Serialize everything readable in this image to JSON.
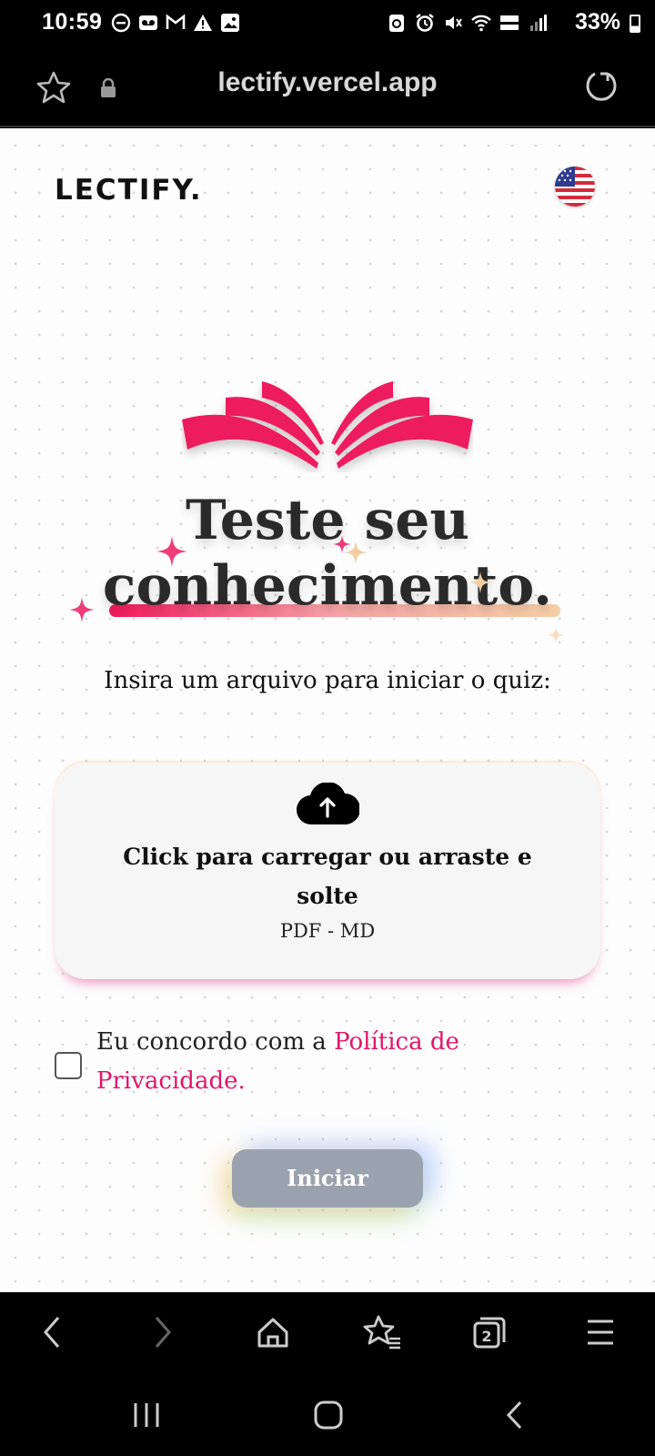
{
  "status_bar": {
    "time": "10:59",
    "battery": "33%"
  },
  "browser": {
    "url": "lectify.vercel.app"
  },
  "header": {
    "logo": "LECTIFY.",
    "language_icon": "us-flag-icon"
  },
  "hero": {
    "title_line1": "Teste seu",
    "title_line2": "conhecimento.",
    "subtitle": "Insira um arquivo para iniciar o quiz:"
  },
  "upload": {
    "text": "Click para carregar ou arraste e solte",
    "formats": "PDF - MD"
  },
  "consent": {
    "text": "Eu concordo com a ",
    "link": "Política de Privacidade.",
    "checked": false
  },
  "actions": {
    "start_label": "Iniciar"
  },
  "colors": {
    "accent": "#e0176a",
    "button_disabled": "#9aa2ae"
  }
}
